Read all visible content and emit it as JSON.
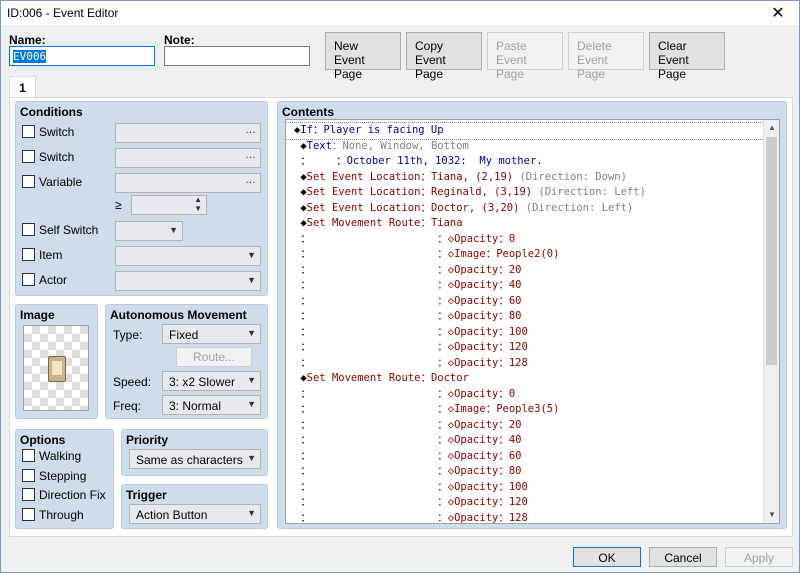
{
  "window": {
    "title": "ID:006 - Event Editor",
    "close": "✕"
  },
  "name": {
    "label": "Name:",
    "value": "EV006"
  },
  "note": {
    "label": "Note:",
    "value": ""
  },
  "page_buttons": [
    {
      "l1": "New",
      "l2": "Event Page",
      "enabled": true
    },
    {
      "l1": "Copy",
      "l2": "Event Page",
      "enabled": true
    },
    {
      "l1": "Paste",
      "l2": "Event Page",
      "enabled": false
    },
    {
      "l1": "Delete",
      "l2": "Event Page",
      "enabled": false
    },
    {
      "l1": "Clear",
      "l2": "Event Page",
      "enabled": true
    }
  ],
  "tab": "1",
  "conditions": {
    "title": "Conditions",
    "items": [
      {
        "label": "Switch",
        "value": ""
      },
      {
        "label": "Switch",
        "value": ""
      },
      {
        "label": "Variable",
        "value": ""
      },
      {
        "label": "Self Switch",
        "value": ""
      },
      {
        "label": "Item",
        "value": ""
      },
      {
        "label": "Actor",
        "value": ""
      }
    ],
    "ge": "≥",
    "ellipsis": "…"
  },
  "image": {
    "title": "Image"
  },
  "autonomous": {
    "title": "Autonomous Movement",
    "type_label": "Type:",
    "type_value": "Fixed",
    "route_button": "Route...",
    "speed_label": "Speed:",
    "speed_value": "3: x2 Slower",
    "freq_label": "Freq:",
    "freq_value": "3: Normal"
  },
  "options": {
    "title": "Options",
    "items": [
      "Walking",
      "Stepping",
      "Direction Fix",
      "Through"
    ]
  },
  "priority": {
    "title": "Priority",
    "value": "Same as characters"
  },
  "trigger": {
    "title": "Trigger",
    "value": "Action Button"
  },
  "contents": {
    "title": "Contents",
    "rows": [
      {
        "parts": [
          [
            "c-black",
            "◆"
          ],
          [
            "c-blue",
            "If：Player is facing Up"
          ]
        ]
      },
      {
        "parts": [
          [
            "c-black",
            " ◆"
          ],
          [
            "c-blue",
            "Text"
          ],
          [
            "c-gray",
            "：None, Window, Bottom"
          ]
        ]
      },
      {
        "parts": [
          [
            "c-black",
            " ："
          ],
          [
            "c-blue",
            "    ：October 11th, 1032:  My mother."
          ]
        ]
      },
      {
        "parts": [
          [
            "c-black",
            " ◆"
          ],
          [
            "c-red",
            "Set Event Location：Tiana, (2,19)"
          ],
          [
            "c-gray",
            " (Direction: Down)"
          ]
        ]
      },
      {
        "parts": [
          [
            "c-black",
            " ◆"
          ],
          [
            "c-red",
            "Set Event Location：Reginald, (3,19)"
          ],
          [
            "c-gray",
            " (Direction: Left)"
          ]
        ]
      },
      {
        "parts": [
          [
            "c-black",
            " ◆"
          ],
          [
            "c-red",
            "Set Event Location：Doctor, (3,20)"
          ],
          [
            "c-gray",
            " (Direction: Left)"
          ]
        ]
      },
      {
        "parts": [
          [
            "c-black",
            " ◆"
          ],
          [
            "c-red",
            "Set Movement Route：Tiana"
          ]
        ]
      },
      {
        "parts": [
          [
            "c-black",
            " ："
          ],
          [
            "c-red",
            "                    ：◇Opacity：0"
          ]
        ]
      },
      {
        "parts": [
          [
            "c-black",
            " ："
          ],
          [
            "c-red",
            "                    ：◇Image：People2(0)"
          ]
        ]
      },
      {
        "parts": [
          [
            "c-black",
            " ："
          ],
          [
            "c-red",
            "                    ：◇Opacity：20"
          ]
        ]
      },
      {
        "parts": [
          [
            "c-black",
            " ："
          ],
          [
            "c-red",
            "                    ：◇Opacity：40"
          ]
        ]
      },
      {
        "parts": [
          [
            "c-black",
            " ："
          ],
          [
            "c-red",
            "                    ：◇Opacity：60"
          ]
        ]
      },
      {
        "parts": [
          [
            "c-black",
            " ："
          ],
          [
            "c-red",
            "                    ：◇Opacity：80"
          ]
        ]
      },
      {
        "parts": [
          [
            "c-black",
            " ："
          ],
          [
            "c-red",
            "                    ：◇Opacity：100"
          ]
        ]
      },
      {
        "parts": [
          [
            "c-black",
            " ："
          ],
          [
            "c-red",
            "                    ：◇Opacity：120"
          ]
        ]
      },
      {
        "parts": [
          [
            "c-black",
            " ："
          ],
          [
            "c-red",
            "                    ：◇Opacity：128"
          ]
        ]
      },
      {
        "parts": [
          [
            "c-black",
            " ◆"
          ],
          [
            "c-red",
            "Set Movement Route：Doctor"
          ]
        ]
      },
      {
        "parts": [
          [
            "c-black",
            " ："
          ],
          [
            "c-red",
            "                    ：◇Opacity：0"
          ]
        ]
      },
      {
        "parts": [
          [
            "c-black",
            " ："
          ],
          [
            "c-red",
            "                    ：◇Image：People3(5)"
          ]
        ]
      },
      {
        "parts": [
          [
            "c-black",
            " ："
          ],
          [
            "c-red",
            "                    ：◇Opacity：20"
          ]
        ]
      },
      {
        "parts": [
          [
            "c-black",
            " ："
          ],
          [
            "c-red",
            "                    ：◇Opacity：40"
          ]
        ]
      },
      {
        "parts": [
          [
            "c-black",
            " ："
          ],
          [
            "c-red",
            "                    ：◇Opacity：60"
          ]
        ]
      },
      {
        "parts": [
          [
            "c-black",
            " ："
          ],
          [
            "c-red",
            "                    ：◇Opacity：80"
          ]
        ]
      },
      {
        "parts": [
          [
            "c-black",
            " ："
          ],
          [
            "c-red",
            "                    ：◇Opacity：100"
          ]
        ]
      },
      {
        "parts": [
          [
            "c-black",
            " ："
          ],
          [
            "c-red",
            "                    ：◇Opacity：120"
          ]
        ]
      },
      {
        "parts": [
          [
            "c-black",
            " ："
          ],
          [
            "c-red",
            "                    ：◇Opacity：128"
          ]
        ]
      }
    ]
  },
  "footer": {
    "ok": "OK",
    "cancel": "Cancel",
    "apply": "Apply"
  }
}
